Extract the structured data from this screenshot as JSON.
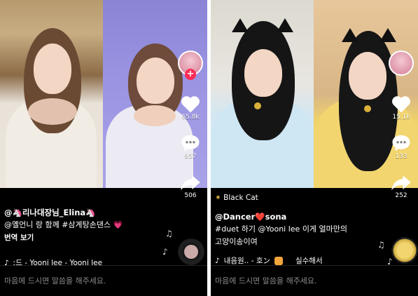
{
  "left_panel": {
    "likes": "65.8k",
    "comments": "957",
    "shares": "506",
    "handle": "@🦄리나대장님_Elina🦄",
    "caption": "@옐언니 랑 함께 #삼계탕손댄스 💗",
    "translate": "번역 보기",
    "music": "ː드 - Yooni lee - Yooni lee",
    "comment_placeholder": "마음에 드시면 말씀을 해주세요."
  },
  "right_panel": {
    "effect": "Black Cat",
    "likes": "15.1k",
    "comments": "133",
    "shares": "252",
    "handle": "@Dancer❤️sona",
    "caption_line1": "#duet 하기 @Yooni lee  이게 얼마만의",
    "caption_line2": "고양이송이여",
    "music_a": "내음원.. - 호ン",
    "music_b": "실수해서",
    "comment_placeholder": "마음에 드시면 말씀을 해주세요."
  },
  "colors": {
    "accent": "#fe2c55",
    "background": "#000000",
    "muted_text": "#8a8a8a"
  },
  "icons": [
    "heart-icon",
    "comment-icon",
    "share-icon",
    "music-note-icon",
    "plus-icon",
    "record-disc-icon",
    "sparkle-icon"
  ]
}
